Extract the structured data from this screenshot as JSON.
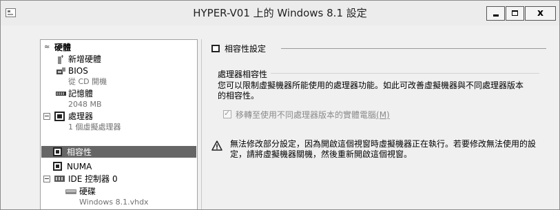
{
  "window": {
    "title": "HYPER-V01 上的 Windows 8.1 設定"
  },
  "tree": {
    "hardware": "硬體",
    "add_hardware": "新增硬體",
    "bios": "BIOS",
    "bios_sub": "從 CD 開機",
    "memory": "記憶體",
    "memory_sub": "2048 MB",
    "processor": "處理器",
    "processor_sub": "1 個虛擬處理器",
    "compatibility": "相容性",
    "numa": "NUMA",
    "ide": "IDE 控制器 0",
    "hard_drive": "硬碟",
    "hard_drive_sub": "Windows 8.1.vhdx"
  },
  "panel": {
    "header": "相容性設定",
    "group_label": "處理器相容性",
    "description": "您可以限制虛擬機器所能使用的處理器功能。如此可改善虛擬機器與不同處理器版本的相容性。",
    "checkbox_label": "移轉至使用不同處理器版本的實體電腦",
    "checkbox_accel_text": "(M)",
    "warning": "無法修改部分設定，因為開啟這個視窗時虛擬機器正在執行。若要修改無法使用的設定，請將虛擬機器關機，然後重新開啟這個視窗。"
  },
  "icons": {
    "app": "settings-window-icon",
    "hardware_collapse": "double-chevron-up-icon",
    "add_hardware": "add-hardware-icon",
    "bios": "bios-chip-icon",
    "memory": "memory-icon",
    "processor": "processor-icon",
    "compat": "processor-icon",
    "numa": "processor-icon",
    "ide": "ide-controller-icon",
    "hard_drive": "hard-drive-icon",
    "warning": "warning-icon"
  },
  "colors": {
    "selection": "#666666",
    "disabled_text": "#8a8a8a"
  }
}
